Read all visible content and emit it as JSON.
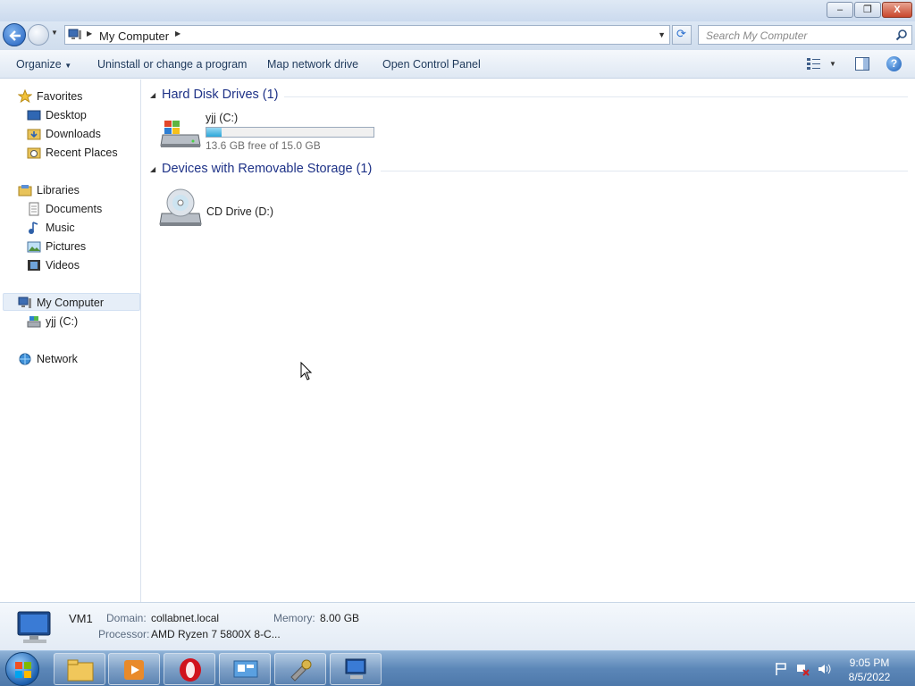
{
  "window": {
    "caption_buttons": {
      "minimize": "–",
      "maximize": "❐",
      "close": "X"
    }
  },
  "address": {
    "location": "My Computer",
    "search_placeholder": "Search My Computer"
  },
  "toolbar": {
    "organize": "Organize",
    "uninstall": "Uninstall or change a program",
    "map_drive": "Map network drive",
    "control_panel": "Open Control Panel",
    "help": "?"
  },
  "nav": {
    "favorites": "Favorites",
    "desktop": "Desktop",
    "downloads": "Downloads",
    "recent": "Recent Places",
    "libraries": "Libraries",
    "documents": "Documents",
    "music": "Music",
    "pictures": "Pictures",
    "videos": "Videos",
    "computer": "My Computer",
    "drive_c": "yjj (C:)",
    "network": "Network"
  },
  "content": {
    "hdd_group": "Hard Disk Drives (1)",
    "removable_group": "Devices with Removable Storage (1)",
    "drive_c": {
      "name": "yjj (C:)",
      "free_text": "13.6 GB free of 15.0 GB",
      "used_fraction": 0.093
    },
    "drive_d": {
      "name": "CD Drive (D:)"
    }
  },
  "details": {
    "computer_name": "VM1",
    "domain_label": "Domain:",
    "domain_value": "collabnet.local",
    "memory_label": "Memory:",
    "memory_value": "8.00 GB",
    "processor_label": "Processor:",
    "processor_value": "AMD Ryzen 7 5800X 8-C..."
  },
  "taskbar": {
    "time": "9:05 PM",
    "date": "8/5/2022"
  },
  "colors": {
    "accent": "#1e3287",
    "bar_fill": "#2ba7d9"
  }
}
